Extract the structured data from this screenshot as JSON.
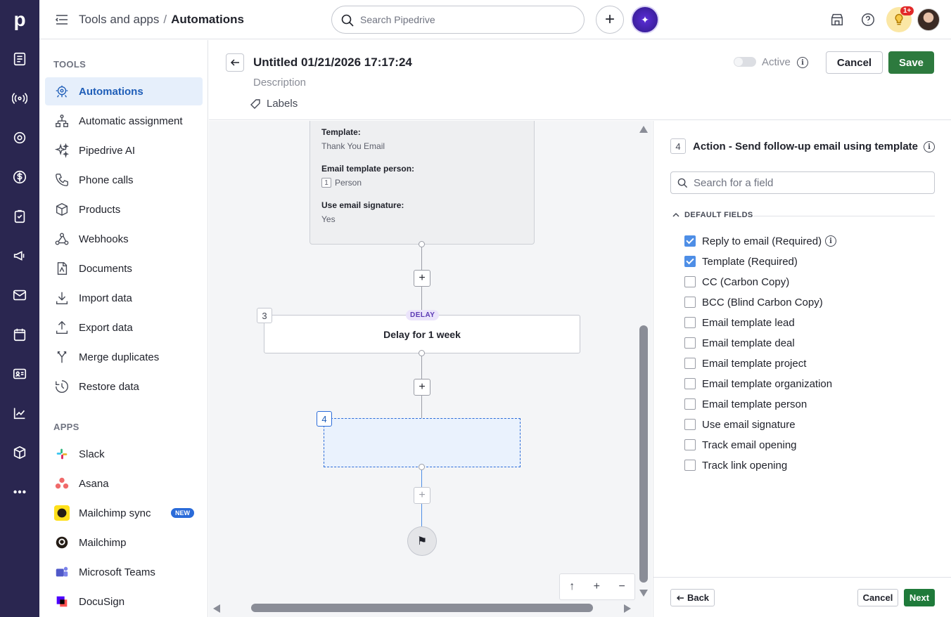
{
  "app": {
    "logo": "p"
  },
  "topbar": {
    "breadcrumb_parent": "Tools and apps",
    "breadcrumb_sep": "/",
    "breadcrumb_current": "Automations",
    "search_placeholder": "Search Pipedrive",
    "notification_badge": "1+"
  },
  "sidebar": {
    "tools_title": "TOOLS",
    "tools": [
      {
        "label": "Automations",
        "icon": "automations-icon",
        "active": true
      },
      {
        "label": "Automatic assignment",
        "icon": "assignment-icon"
      },
      {
        "label": "Pipedrive AI",
        "icon": "sparkle-icon"
      },
      {
        "label": "Phone calls",
        "icon": "phone-icon"
      },
      {
        "label": "Products",
        "icon": "box-icon"
      },
      {
        "label": "Webhooks",
        "icon": "webhook-icon"
      },
      {
        "label": "Documents",
        "icon": "document-icon"
      },
      {
        "label": "Import data",
        "icon": "download-icon"
      },
      {
        "label": "Export data",
        "icon": "upload-icon"
      },
      {
        "label": "Merge duplicates",
        "icon": "merge-icon"
      },
      {
        "label": "Restore data",
        "icon": "restore-icon"
      }
    ],
    "apps_title": "APPS",
    "apps": [
      {
        "label": "Slack",
        "icon": "slack-icon"
      },
      {
        "label": "Asana",
        "icon": "asana-icon"
      },
      {
        "label": "Mailchimp sync",
        "icon": "mailchimp-icon",
        "badge": "NEW"
      },
      {
        "label": "Mailchimp",
        "icon": "mailchimp-icon"
      },
      {
        "label": "Microsoft Teams",
        "icon": "teams-icon"
      },
      {
        "label": "DocuSign",
        "icon": "docusign-icon"
      }
    ]
  },
  "editor": {
    "title": "Untitled 01/21/2026 17:17:24",
    "description_placeholder": "Description",
    "labels": "Labels",
    "active_label": "Active",
    "cancel": "Cancel",
    "save": "Save"
  },
  "canvas": {
    "card": {
      "template_label": "Template:",
      "template_value": "Thank You Email",
      "person_label": "Email template person:",
      "person_num": "1",
      "person_value": "Person",
      "signature_label": "Use email signature:",
      "signature_value": "Yes"
    },
    "delay_step_num": "3",
    "delay_tag": "DELAY",
    "delay_text": "Delay for 1 week",
    "new_step_num": "4"
  },
  "panel": {
    "step_num": "4",
    "title": "Action - Send follow-up email using template",
    "search_placeholder": "Search for a field",
    "section_title": "DEFAULT FIELDS",
    "fields": [
      {
        "label": "Reply to email (Required)",
        "checked": true,
        "info": true
      },
      {
        "label": "Template (Required)",
        "checked": true
      },
      {
        "label": "CC (Carbon Copy)",
        "checked": false
      },
      {
        "label": "BCC (Blind Carbon Copy)",
        "checked": false
      },
      {
        "label": "Email template lead",
        "checked": false
      },
      {
        "label": "Email template deal",
        "checked": false
      },
      {
        "label": "Email template project",
        "checked": false
      },
      {
        "label": "Email template organization",
        "checked": false
      },
      {
        "label": "Email template person",
        "checked": false
      },
      {
        "label": "Use email signature",
        "checked": false
      },
      {
        "label": "Track email opening",
        "checked": false
      },
      {
        "label": "Track link opening",
        "checked": false
      }
    ],
    "back": "Back",
    "cancel": "Cancel",
    "next": "Next"
  },
  "colors": {
    "rail": "#2a2650",
    "active_bg": "#e6effb",
    "active_text": "#1f5eb8",
    "save_green": "#2d7a3e",
    "checkbox_blue": "#4e8ee6"
  }
}
